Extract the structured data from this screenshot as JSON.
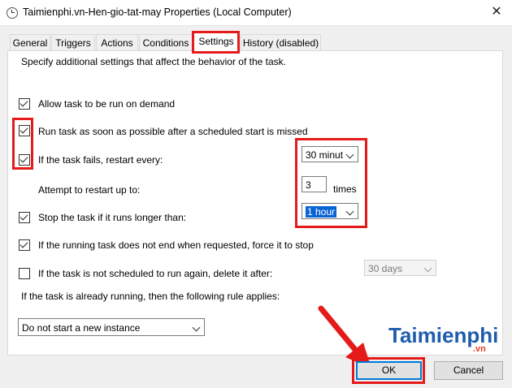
{
  "window": {
    "title": "Taimienphi.vn-Hen-gio-tat-may Properties (Local Computer)",
    "close": "✕"
  },
  "tabs": [
    {
      "label": "General"
    },
    {
      "label": "Triggers"
    },
    {
      "label": "Actions"
    },
    {
      "label": "Conditions"
    },
    {
      "label": "Settings"
    },
    {
      "label": "History (disabled)"
    }
  ],
  "settings": {
    "intro": "Specify additional settings that affect the behavior of the task.",
    "allow_run": "Allow task to be run on demand",
    "run_asap": "Run task as soon as possible after a scheduled start is missed",
    "restart_every": "If the task fails, restart every:",
    "restart_every_value": "30 minut",
    "attempt_restart": "Attempt to restart up to:",
    "attempt_value": "3",
    "times": "times",
    "stop_longer": "Stop the task if it runs longer than:",
    "stop_longer_value": "1 hour",
    "force_stop": "If the running task does not end when requested, force it to stop",
    "delete_after": "If the task is not scheduled to run again, delete it after:",
    "delete_after_value": "30 days",
    "rule_label": "If the task is already running, then the following rule applies:",
    "rule_value": "Do not start a new instance"
  },
  "buttons": {
    "ok": "OK",
    "cancel": "Cancel"
  },
  "watermark": {
    "brand": "Taimienphi",
    "tld": ".vn"
  },
  "colors": {
    "highlight_red": "#e51b1b",
    "selection_blue": "#0a64d6",
    "default_button": "#0078d7"
  }
}
